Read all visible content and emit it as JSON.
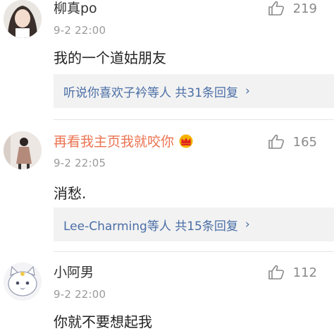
{
  "comments": [
    {
      "username": "柳真po",
      "likes": "219",
      "time": "9-2 22:00",
      "text": "我的一个道姑朋友",
      "replies": {
        "summary": "听说你喜欢子衿等人 共31条回复",
        "arrow": "›"
      }
    },
    {
      "username": "再看我主页我就咬你",
      "username_color": "#eb7350",
      "badge": "crown-vip-badge",
      "likes": "165",
      "time": "9-2 22:05",
      "text": "消愁.",
      "replies": {
        "summary": "Lee-Charming等人 共15条回复",
        "arrow": "›"
      }
    },
    {
      "username": "小阿男",
      "likes": "112",
      "time": "9-2 22:00",
      "text": "你就不要想起我"
    }
  ],
  "colors": {
    "link": "#4a6ea6",
    "reply_bg": "#f2f2f2",
    "vip_name": "#eb7350",
    "meta": "#9a9a9a"
  }
}
